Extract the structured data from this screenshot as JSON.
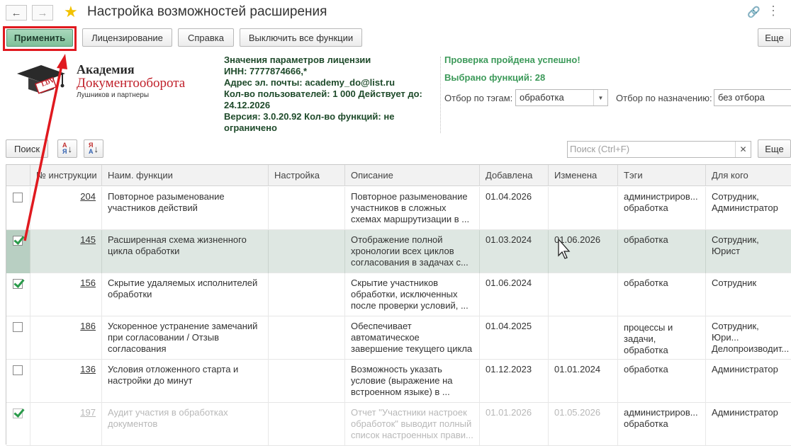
{
  "window": {
    "title": "Настройка возможностей расширения",
    "more_label": "Еще"
  },
  "toolbar": {
    "apply": "Применить",
    "licensing": "Лицензирование",
    "help": "Справка",
    "disable_all": "Выключить все функции",
    "more": "Еще"
  },
  "logo": {
    "line1": "Академия",
    "line2": "Документооборота",
    "line3": "Лушников и партнеры",
    "badge": "LDV"
  },
  "license": {
    "heading": "Значения параметров лицензии",
    "inn": "ИНН: 7777874666,*",
    "email": "Адрес эл. почты: academy_do@list.ru",
    "users_line1": "Кол-во пользователей: 1 000 Действует до:",
    "users_line2": "24.12.2026",
    "version_line1": "Версия: 3.0.20.92 Кол-во функций: не",
    "version_line2": "ограничено"
  },
  "status": {
    "check": "Проверка пройдена успешно!",
    "selected": "Выбрано функций: 28"
  },
  "filters": {
    "tag_label": "Отбор по тэгам:",
    "tag_value": "обработка",
    "purpose_label": "Отбор по назначению:",
    "purpose_value": "без отбора"
  },
  "search": {
    "button": "Поиск",
    "placeholder": "Поиск (Ctrl+F)",
    "more": "Еще"
  },
  "columns": [
    "№ инструкции",
    "Наим. функции",
    "Настройка",
    "Описание",
    "Добавлена",
    "Изменена",
    "Тэги",
    "Для кого"
  ],
  "rows": [
    {
      "checked": false,
      "num": "204",
      "name": "Повторное разыменование участников действий",
      "setting": "",
      "desc": "Повторное разыменование участников в сложных схемах маршрутизации в ...",
      "added": "01.04.2026",
      "changed": "",
      "tags": "администриров... обработка",
      "for": "Сотрудник, Администратор"
    },
    {
      "checked": true,
      "num": "145",
      "name": "Расширенная схема жизненного цикла обработки",
      "setting": "",
      "desc": "Отображение полной хронологии всех циклов согласования в задачах с...",
      "added": "01.03.2024",
      "changed": "01.06.2026",
      "tags": "обработка",
      "for": "Сотрудник, Юрист"
    },
    {
      "checked": true,
      "num": "156",
      "name": "Скрытие удаляемых исполнителей обработки",
      "setting": "",
      "desc": "Скрытие участников обработки, исключенных после проверки условий, ...",
      "added": "01.06.2024",
      "changed": "",
      "tags": "обработка",
      "for": "Сотрудник"
    },
    {
      "checked": false,
      "num": "186",
      "name": "Ускоренное устранение замечаний при согласовании / Отзыв согласования",
      "setting": "",
      "desc": "Обеспечивает автоматическое завершение текущего цикла ...",
      "added": "01.04.2025",
      "changed": "",
      "tags": "процессы и задачи, обработка",
      "for": "Сотрудник, Юри... Делопроизводит..."
    },
    {
      "checked": false,
      "num": "136",
      "name": "Условия отложенного старта и настройки до минут",
      "setting": "",
      "desc": "Возможность указать условие (выражение на встроенном языке) в ...",
      "added": "01.12.2023",
      "changed": "01.01.2024",
      "tags": "обработка",
      "for": "Администратор"
    },
    {
      "checked": true,
      "num": "197",
      "name": "Аудит участия в обработках документов",
      "setting": "",
      "desc": "Отчет \"Участники настроек обработок\" выводит полный список настроенных прави...",
      "added": "01.01.2026",
      "changed": "01.05.2026",
      "tags": "администриров... обработка",
      "for": "Администратор"
    }
  ]
}
